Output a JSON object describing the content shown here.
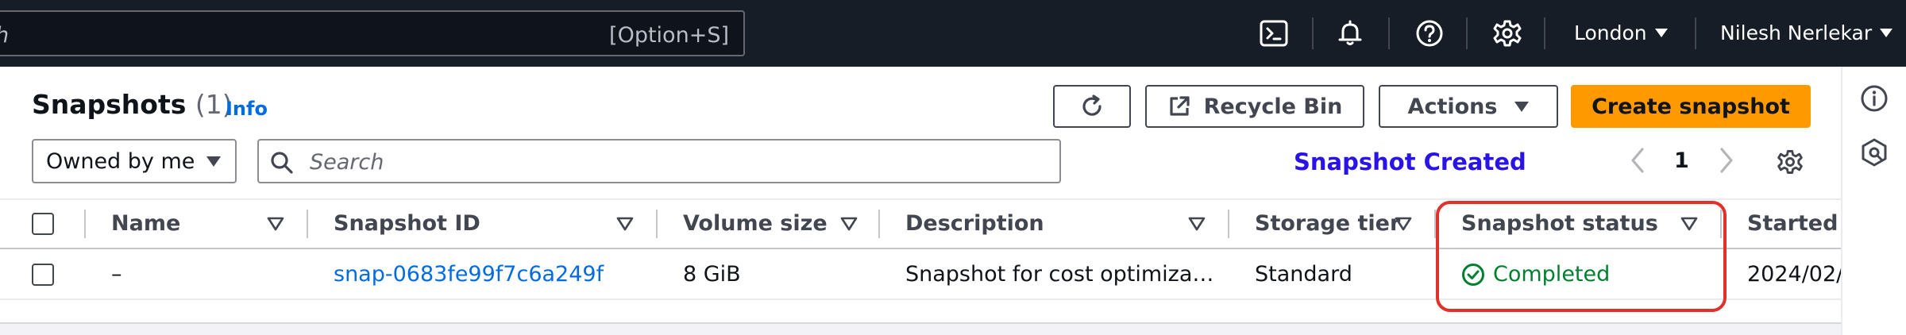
{
  "topnav": {
    "search_placeholder": "h",
    "search_shortcut": "[Option+S]",
    "region": "London",
    "user": "Nilesh Nerlekar"
  },
  "header": {
    "title": "Snapshots",
    "count": "(1)",
    "info": "Info"
  },
  "toolbar": {
    "recycle_bin": "Recycle Bin",
    "actions": "Actions",
    "create": "Create snapshot"
  },
  "filters": {
    "owner_select": "Owned by me",
    "search_placeholder": "Search",
    "notice": "Snapshot Created",
    "page": "1"
  },
  "table": {
    "columns": [
      "Name",
      "Snapshot ID",
      "Volume size",
      "Description",
      "Storage tier",
      "Snapshot status",
      "Started"
    ],
    "rows": [
      {
        "name": "–",
        "snapshot_id": "snap-0683fe99f7c6a249f",
        "volume_size": "8 GiB",
        "description": "Snapshot for cost optimiza…",
        "storage_tier": "Standard",
        "status": "Completed",
        "started": "2024/02/"
      }
    ]
  },
  "colors": {
    "nav_bg": "#161d26",
    "primary_button": "#ff9900",
    "link": "#006ce0",
    "status_success": "#00802f",
    "notice_text": "#2a13e6",
    "highlight_border": "#e0312a"
  }
}
